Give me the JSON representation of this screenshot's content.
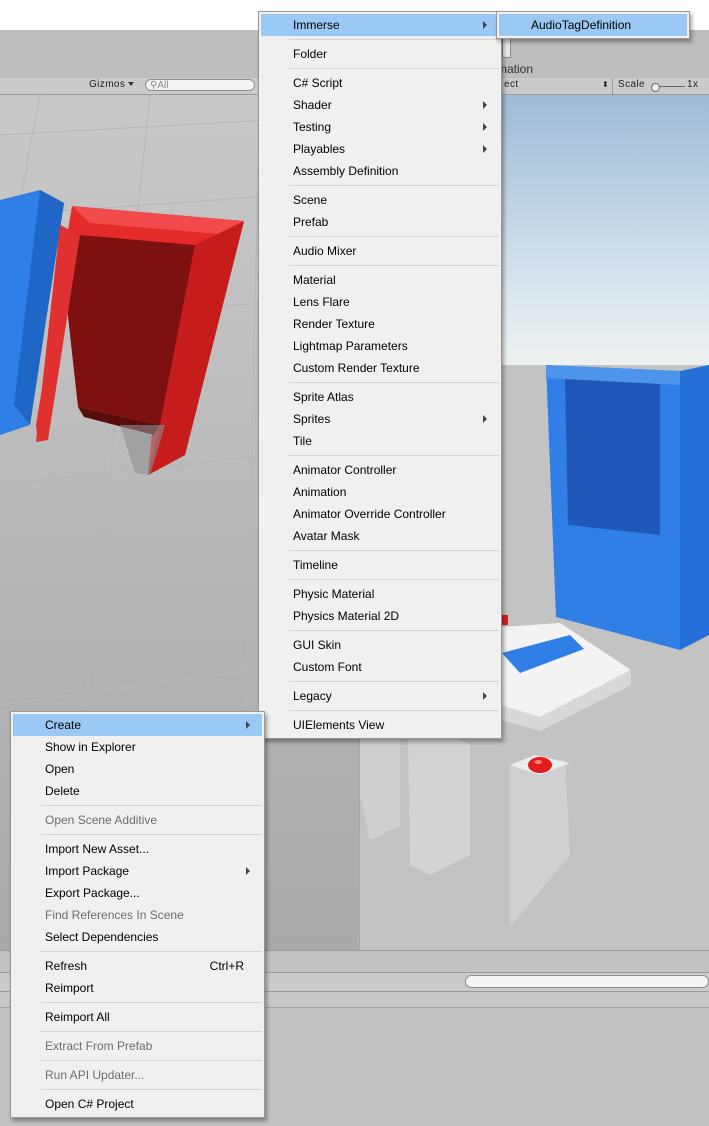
{
  "toolbar": {
    "gizmos_label": "Gizmos",
    "search_placeholder": "All",
    "right_tab_partial": "mation",
    "dropdown_partial": "ect",
    "scale_label": "Scale",
    "scale_value": "1x"
  },
  "create_submenu": {
    "items": [
      {
        "label": "Immerse",
        "submenu": true,
        "highlight": true
      },
      {
        "sep": true
      },
      {
        "label": "Folder"
      },
      {
        "sep": true
      },
      {
        "label": "C# Script"
      },
      {
        "label": "Shader",
        "submenu": true
      },
      {
        "label": "Testing",
        "submenu": true
      },
      {
        "label": "Playables",
        "submenu": true
      },
      {
        "label": "Assembly Definition"
      },
      {
        "sep": true
      },
      {
        "label": "Scene"
      },
      {
        "label": "Prefab"
      },
      {
        "sep": true
      },
      {
        "label": "Audio Mixer"
      },
      {
        "sep": true
      },
      {
        "label": "Material"
      },
      {
        "label": "Lens Flare"
      },
      {
        "label": "Render Texture"
      },
      {
        "label": "Lightmap Parameters"
      },
      {
        "label": "Custom Render Texture"
      },
      {
        "sep": true
      },
      {
        "label": "Sprite Atlas"
      },
      {
        "label": "Sprites",
        "submenu": true
      },
      {
        "label": "Tile"
      },
      {
        "sep": true
      },
      {
        "label": "Animator Controller"
      },
      {
        "label": "Animation"
      },
      {
        "label": "Animator Override Controller"
      },
      {
        "label": "Avatar Mask"
      },
      {
        "sep": true
      },
      {
        "label": "Timeline"
      },
      {
        "sep": true
      },
      {
        "label": "Physic Material"
      },
      {
        "label": "Physics Material 2D"
      },
      {
        "sep": true
      },
      {
        "label": "GUI Skin"
      },
      {
        "label": "Custom Font"
      },
      {
        "sep": true
      },
      {
        "label": "Legacy",
        "submenu": true
      },
      {
        "sep": true
      },
      {
        "label": "UIElements View"
      }
    ]
  },
  "immerse_submenu": {
    "items": [
      {
        "label": "AudioTagDefinition",
        "highlight": true
      }
    ]
  },
  "context_menu": {
    "items": [
      {
        "label": "Create",
        "submenu": true,
        "highlight": true
      },
      {
        "label": "Show in Explorer"
      },
      {
        "label": "Open"
      },
      {
        "label": "Delete"
      },
      {
        "sep": true
      },
      {
        "label": "Open Scene Additive",
        "disabled": true
      },
      {
        "sep": true
      },
      {
        "label": "Import New Asset..."
      },
      {
        "label": "Import Package",
        "submenu": true
      },
      {
        "label": "Export Package..."
      },
      {
        "label": "Find References In Scene",
        "disabled": true
      },
      {
        "label": "Select Dependencies"
      },
      {
        "sep": true
      },
      {
        "label": "Refresh",
        "shortcut": "Ctrl+R"
      },
      {
        "label": "Reimport"
      },
      {
        "sep": true
      },
      {
        "label": "Reimport All"
      },
      {
        "sep": true
      },
      {
        "label": "Extract From Prefab",
        "disabled": true
      },
      {
        "sep": true
      },
      {
        "label": "Run API Updater...",
        "disabled": true
      },
      {
        "sep": true
      },
      {
        "label": "Open C# Project"
      }
    ]
  },
  "colors": {
    "highlight": "#99c9f4",
    "menu_bg": "#f0f0f0",
    "red_object": "#e52a2a",
    "blue_object": "#2f7fe6"
  }
}
